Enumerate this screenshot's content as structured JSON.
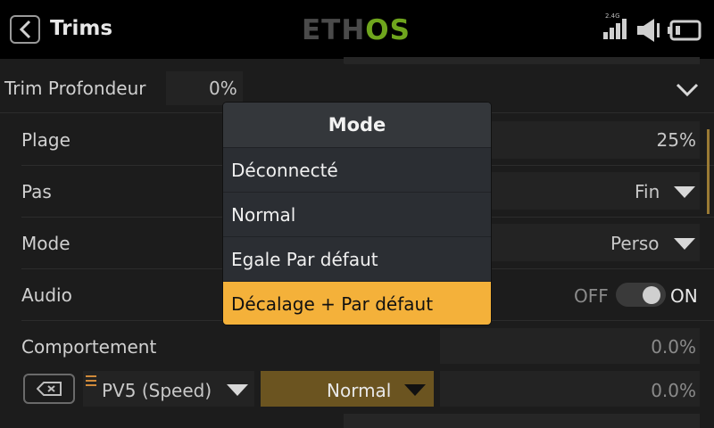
{
  "header": {
    "title": "Trims",
    "logo_left": "ETH",
    "logo_right": "OS",
    "radio_band": "2.4G",
    "icons": [
      "back-arrow-icon",
      "signal-bars-icon",
      "speaker-icon",
      "battery-icon"
    ]
  },
  "rows": {
    "trim_label": "Trim Profondeur",
    "trim_value": "0%",
    "plage_label": "Plage",
    "plage_value": "25%",
    "pas_label": "Pas",
    "pas_value": "Fin",
    "mode_label": "Mode",
    "mode_value": "Perso",
    "audio_label": "Audio",
    "audio_off": "OFF",
    "audio_on": "ON",
    "audio_state": "on",
    "comportement_label": "Comportement",
    "comportement_value": "0.0%",
    "source_value": "PV5 (Speed)",
    "normal_value": "Normal",
    "last_value": "0.0%"
  },
  "modal": {
    "title": "Mode",
    "options": [
      "Déconnecté",
      "Normal",
      "Egale Par défaut",
      "Décalage + Par défaut"
    ],
    "selected_index": 3
  },
  "colors": {
    "accent": "#f4b13a",
    "logo_green": "#6fa51d",
    "background": "#1c1c1c"
  }
}
